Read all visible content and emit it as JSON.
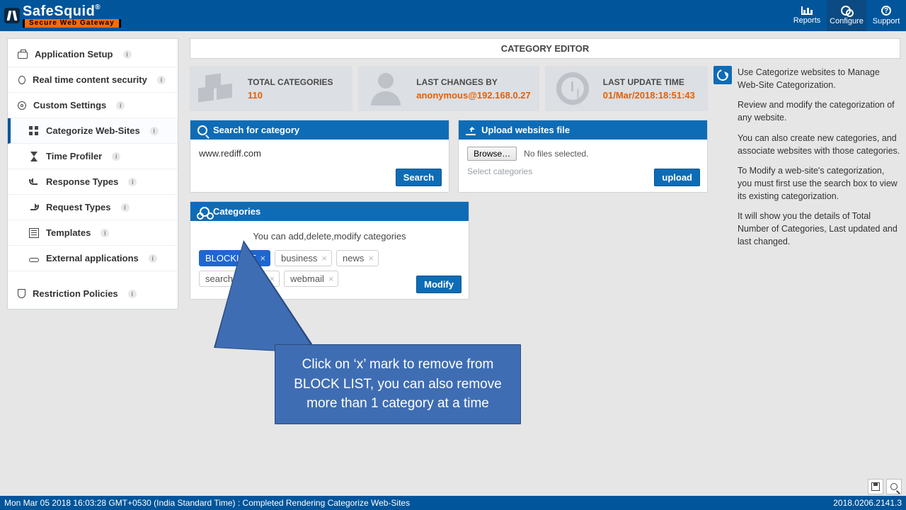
{
  "brand": {
    "name": "SafeSquid",
    "reg": "®",
    "tagline": "Secure Web Gateway"
  },
  "topnav": {
    "items": [
      {
        "key": "reports",
        "label": "Reports"
      },
      {
        "key": "configure",
        "label": "Configure"
      },
      {
        "key": "support",
        "label": "Support"
      }
    ],
    "active": "configure"
  },
  "sidebar": {
    "groups": [
      {
        "label": "Application Setup",
        "icon": "briefcase"
      },
      {
        "label": "Real time content security",
        "icon": "bug"
      },
      {
        "label": "Custom Settings",
        "icon": "gear"
      }
    ],
    "subitems": [
      {
        "label": "Categorize Web-Sites",
        "icon": "grid",
        "active": true
      },
      {
        "label": "Time Profiler",
        "icon": "hourglass"
      },
      {
        "label": "Response Types",
        "icon": "back"
      },
      {
        "label": "Request Types",
        "icon": "fwd"
      },
      {
        "label": "Templates",
        "icon": "tpl"
      },
      {
        "label": "External applications",
        "icon": "link"
      }
    ],
    "footer": {
      "label": "Restriction Policies",
      "icon": "shield"
    }
  },
  "page": {
    "title": "CATEGORY EDITOR"
  },
  "stats": {
    "total": {
      "label": "TOTAL CATEGORIES",
      "value": "110"
    },
    "changes": {
      "label": "LAST CHANGES BY",
      "value": "anonymous@192.168.0.27"
    },
    "update": {
      "label": "LAST UPDATE TIME",
      "value": "01/Mar/2018:18:51:43"
    }
  },
  "panels": {
    "search": {
      "title": "Search for category",
      "value": "www.rediff.com",
      "button": "Search"
    },
    "upload": {
      "title": "Upload websites file",
      "browse": "Browse…",
      "nofile": "No files selected.",
      "select_hint": "Select categories",
      "button": "upload"
    },
    "categories": {
      "title": "Categories",
      "hint": "You can add,delete,modify categories",
      "tags": [
        "BLOCKLIST",
        "business",
        "news",
        "searchengines",
        "webmail"
      ],
      "selected_index": 0,
      "button": "Modify"
    }
  },
  "callout": {
    "text": "Click on ‘x’ mark to remove from BLOCK LIST, you can also remove more than 1 category at a time"
  },
  "help": {
    "paragraphs": [
      "Use Categorize websites to Manage Web-Site Categorization.",
      "Review and modify the categorization of any website.",
      "You can also create new categories, and associate websites with those categories.",
      "To Modify a web-site's categorization, you must first use the search box to view its existing categorization.",
      "It will show you the details of Total Number of Categories, Last updated and last changed."
    ]
  },
  "statusbar": {
    "left": "Mon Mar 05 2018 16:03:28 GMT+0530 (India Standard Time) : Completed Rendering Categorize Web-Sites",
    "right": "2018.0206.2141.3"
  }
}
